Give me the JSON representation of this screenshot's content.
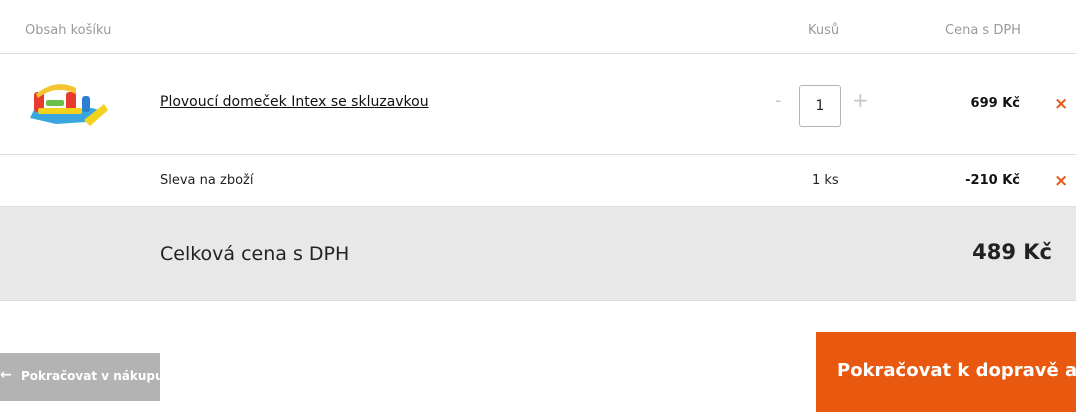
{
  "header": {
    "content_label": "Obsah košíku",
    "qty_label": "Kusů",
    "price_label": "Cena s DPH"
  },
  "product": {
    "name": "Plovoucí domeček Intex se skluzavkou",
    "quantity": "1",
    "minus": "-",
    "plus": "+",
    "price": "699 Kč",
    "remove_icon": "×"
  },
  "discount": {
    "name": "Sleva na zboží",
    "quantity": "1 ks",
    "price": "-210 Kč",
    "remove_icon": "×"
  },
  "total": {
    "label": "Celková cena s DPH",
    "price": "489 Kč"
  },
  "buttons": {
    "back_arrow": "←",
    "back_label": "Pokračovat v nákupu",
    "continue_label": "Pokračovat k dopravě a p"
  },
  "colors": {
    "accent": "#e8590f",
    "remove": "#e8571a",
    "total_bg": "#e8e8e8",
    "back_bg": "#b3b3b3"
  }
}
